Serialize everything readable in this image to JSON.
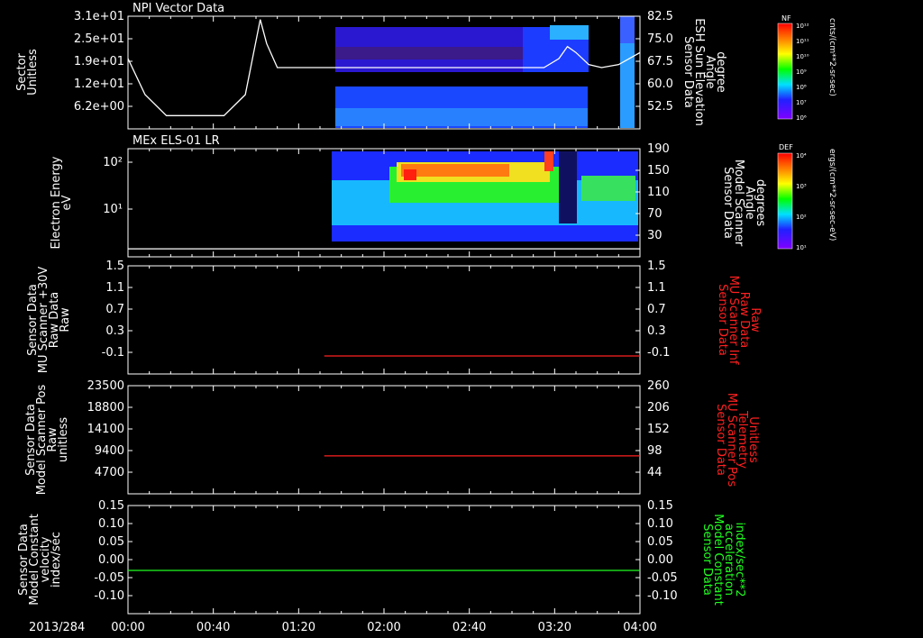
{
  "date": "2013/284",
  "time_ticks": [
    "00:00",
    "00:40",
    "01:20",
    "02:00",
    "02:40",
    "03:20",
    "04:00"
  ],
  "colors": {
    "background": "#000000",
    "axes": "#ffffff",
    "red_trace": "#ff2020",
    "green_trace": "#20ff20"
  },
  "colorbars": [
    {
      "tag": "NF",
      "unit": "cnts/(cm**2-sr-sec)",
      "ticks": [
        "10¹²",
        "10¹¹",
        "10¹⁰",
        "10⁹",
        "10⁸",
        "10⁷",
        "10⁶"
      ]
    },
    {
      "tag": "DEF",
      "unit": "ergs/(cm**2-sr-sec-eV)",
      "ticks": [
        "10⁴",
        "10³",
        "10²",
        "10¹"
      ]
    }
  ],
  "chart_data": [
    {
      "type": "heatmap",
      "title": "NPI Vector Data",
      "ylabel": [
        "Sector",
        "Unitless"
      ],
      "yticks": [
        "3.1e+01",
        "2.5e+01",
        "1.9e+01",
        "1.2e+01",
        "6.2e+00"
      ],
      "y2label": [
        "Sensor Data",
        "ESH Sun Elevation",
        "Angle",
        "degree"
      ],
      "y2ticks": [
        "82.5",
        "75.0",
        "67.5",
        "60.0",
        "52.5"
      ],
      "overlay_line": {
        "name": "ESH Sun Elevation Angle",
        "x_min": [
          0,
          8,
          18,
          45,
          55,
          62,
          65,
          70,
          77,
          80,
          85,
          120,
          150,
          181,
          188,
          195,
          202,
          206,
          210,
          216,
          222,
          230,
          240
        ],
        "y_deg": [
          69,
          57,
          50,
          50,
          57,
          82,
          74,
          66,
          66,
          66,
          66,
          66,
          66,
          66,
          66,
          66,
          69,
          73,
          71,
          67,
          66,
          67,
          71
        ]
      }
    },
    {
      "type": "heatmap",
      "title": "MEx ELS-01 LR",
      "ylabel": [
        "Electron Energy",
        "eV"
      ],
      "yticks": [
        "10²",
        "10¹"
      ],
      "y2label": [
        "Sensor Data",
        "Model Scanner",
        "Angle",
        "degrees"
      ],
      "y2ticks": [
        "190",
        "150",
        "110",
        "70",
        "30"
      ],
      "overlay_line": {
        "name": "Model Scanner Angle",
        "x_min": [
          0,
          240
        ],
        "y_deg": [
          14,
          14
        ]
      }
    },
    {
      "type": "line",
      "ylabel": [
        "Sensor Data",
        "MU Scanner +30V",
        "Raw Data",
        "Raw"
      ],
      "yticks": [
        "1.5",
        "1.1",
        "0.7",
        "0.3",
        "-0.1"
      ],
      "ylim": [
        -0.3,
        1.5
      ],
      "y2label": [
        "Sensor Data",
        "MU Scanner Inf",
        "Raw Data",
        "Raw"
      ],
      "y2ticks": [
        "1.5",
        "1.1",
        "0.7",
        "0.3",
        "-0.1"
      ],
      "series": [
        {
          "color": "#ff2020",
          "x_min": [
            92,
            240
          ],
          "y": [
            0,
            0
          ]
        }
      ]
    },
    {
      "type": "line",
      "ylabel": [
        "Sensor Data",
        "Model Scanner Pos",
        "Raw",
        "unitless"
      ],
      "yticks": [
        "23500",
        "18800",
        "14100",
        "9400",
        "4700"
      ],
      "ylim": [
        0,
        23500
      ],
      "y2label": [
        "Sensor Data",
        "MU Scanner Pos",
        "Telemetry",
        "Unitless"
      ],
      "y2ticks": [
        "260",
        "206",
        "152",
        "98",
        "44"
      ],
      "series": [
        {
          "color": "#ff2020",
          "x_min": [
            92,
            240
          ],
          "y": [
            8250,
            8250
          ]
        }
      ]
    },
    {
      "type": "line",
      "ylabel": [
        "Sensor Data",
        "Model Constant",
        "velocity",
        "index/sec"
      ],
      "yticks": [
        "0.15",
        "0.10",
        "0.05",
        "0.00",
        "-0.05",
        "-0.10"
      ],
      "ylim": [
        -0.1,
        0.15
      ],
      "y2label": [
        "Sensor Data",
        "Model Constant",
        "acceleration",
        "index/sec**2"
      ],
      "y2ticks": [
        "0.15",
        "0.10",
        "0.05",
        "0.00",
        "-0.05",
        "-0.10"
      ],
      "series": [
        {
          "color": "#20ff20",
          "x_min": [
            0,
            240
          ],
          "y": [
            0,
            0
          ]
        }
      ]
    }
  ]
}
